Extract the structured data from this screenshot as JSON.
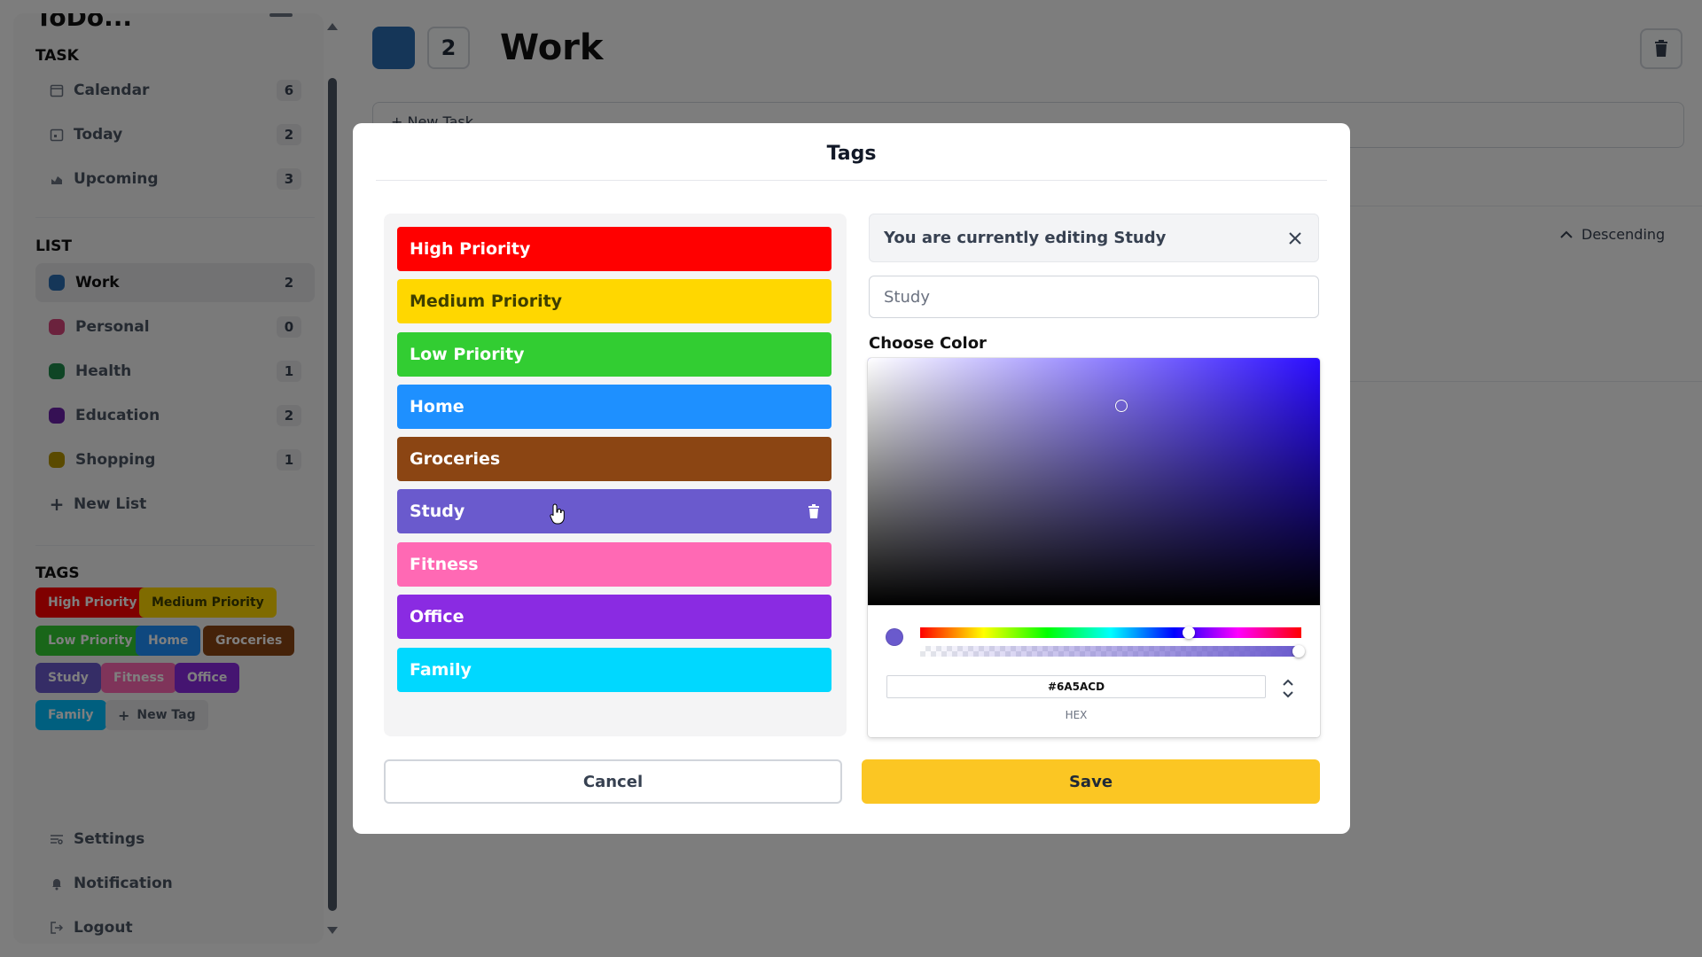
{
  "sidebar": {
    "app_title": "ToDo...",
    "task_heading": "TASK",
    "task_items": [
      {
        "label": "Calendar",
        "count": "6",
        "icon": "calendar-icon"
      },
      {
        "label": "Today",
        "count": "2",
        "icon": "today-icon"
      },
      {
        "label": "Upcoming",
        "count": "3",
        "icon": "upcoming-icon"
      }
    ],
    "list_heading": "LIST",
    "list_items": [
      {
        "label": "Work",
        "count": "2",
        "color": "#2b6cb0"
      },
      {
        "label": "Personal",
        "count": "0",
        "color": "#d6457a"
      },
      {
        "label": "Health",
        "count": "1",
        "color": "#1e8a4a"
      },
      {
        "label": "Education",
        "count": "2",
        "color": "#6b21a8"
      },
      {
        "label": "Shopping",
        "count": "1",
        "color": "#b59500"
      }
    ],
    "new_list_label": "New List",
    "tags_heading": "TAGS",
    "tags": [
      {
        "label": "High Priority",
        "color": "#ff0000"
      },
      {
        "label": "Medium Priority",
        "color": "#ffd700"
      },
      {
        "label": "Low Priority",
        "color": "#32cd32"
      },
      {
        "label": "Home",
        "color": "#1e90ff"
      },
      {
        "label": "Groceries",
        "color": "#8b4513"
      },
      {
        "label": "Study",
        "color": "#6a5acd"
      },
      {
        "label": "Fitness",
        "color": "#ff69b4"
      },
      {
        "label": "Office",
        "color": "#8a2be2"
      },
      {
        "label": "Family",
        "color": "#00bfff"
      }
    ],
    "new_tag_label": "New Tag",
    "settings_label": "Settings",
    "notification_label": "Notification",
    "logout_label": "Logout"
  },
  "main": {
    "list_count": "2",
    "list_title": "Work",
    "list_color": "#2b6cb0",
    "new_task_label": "+ New Task",
    "sort_label": "Descending"
  },
  "modal": {
    "title": "Tags",
    "tags": [
      {
        "label": "High Priority",
        "color": "#ff0000"
      },
      {
        "label": "Medium Priority",
        "color": "#ffd700"
      },
      {
        "label": "Low Priority",
        "color": "#32cd32"
      },
      {
        "label": "Home",
        "color": "#1e90ff"
      },
      {
        "label": "Groceries",
        "color": "#8b4513"
      },
      {
        "label": "Study",
        "color": "#6a5acd"
      },
      {
        "label": "Fitness",
        "color": "#ff69b4"
      },
      {
        "label": "Office",
        "color": "#8a2be2"
      },
      {
        "label": "Family",
        "color": "#00d8ff"
      }
    ],
    "editing_banner": "You are currently editing Study",
    "name_input_value": "Study",
    "choose_color_label": "Choose Color",
    "hex_value": "#6A5ACD",
    "hex_label": "HEX",
    "cancel_label": "Cancel",
    "save_label": "Save",
    "accent_color": "#fbc623"
  }
}
